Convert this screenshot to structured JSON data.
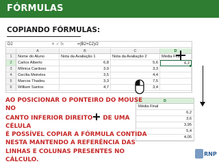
{
  "header": {
    "title": "FÓRMULAS"
  },
  "section": {
    "subtitle": "COPIANDO FÓRMULAS:"
  },
  "spreadsheet": {
    "name_box": "D2",
    "formula_controls": "✕  ✓  fx",
    "formula": "=(B2+C2)/2",
    "columns": [
      "A",
      "B",
      "C",
      "D"
    ],
    "selected_column": "D",
    "rows": [
      {
        "num": "1",
        "a": "Nome do Aluno",
        "b": "Nota da Avaliação 1",
        "c": "Nota da Avaliação 2",
        "d": "Média Final"
      },
      {
        "num": "2",
        "a": "Carlos Alberto",
        "b": "6,8",
        "c": "5,6",
        "d": "6,2"
      },
      {
        "num": "3",
        "a": "Mônica Cardoso",
        "b": "3,9",
        "c": "3,3",
        "d": ""
      },
      {
        "num": "4",
        "a": "Cecília Meireles",
        "b": "3,5",
        "c": "4,4",
        "d": ""
      },
      {
        "num": "5",
        "a": "Marcos Thadeu",
        "b": "3,3",
        "c": "7,5",
        "d": ""
      },
      {
        "num": "6",
        "a": "William Santos",
        "b": "4,7",
        "c": "3,4",
        "d": ""
      }
    ]
  },
  "copied_column": {
    "header": "D",
    "label": "Média Final",
    "values": [
      "6,2",
      "3,6",
      "3,95",
      "5,4",
      "4,05"
    ]
  },
  "explanation": {
    "p1": "AO POSICIONAR O ",
    "p2": "PONTEIRO DO MOUSE",
    "p3": " NO",
    "p4": "CANTO INFERIOR DIREITO",
    "p5": " DE UMA CÉLULA",
    "p6": "É POSSÍVEL ",
    "p7": "COPIAR A FÓRMULA",
    "p8": " CONTIDA",
    "p9": "NESTA",
    "p10": " MANTENDO A REFERÊNCIA ",
    "p11": "DAS",
    "p12": "LINHAS E COLUNAS PRESENTES NO CÁLCULO."
  },
  "logo": {
    "text": "RNP"
  },
  "colors": {
    "header_bg": "#2e7d32",
    "explain_text": "#c62828",
    "excel_green": "#217346"
  }
}
